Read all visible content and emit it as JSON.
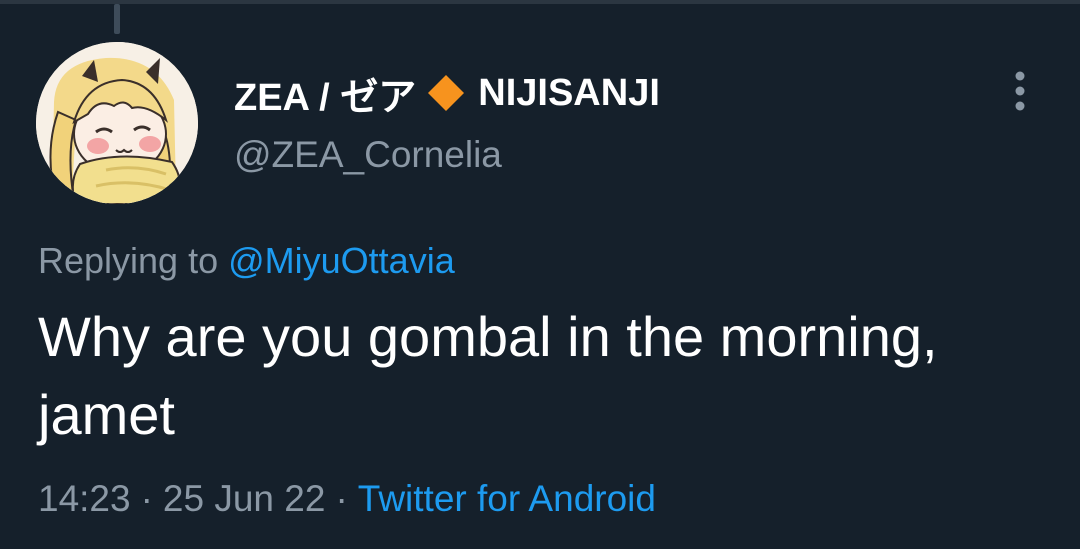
{
  "author": {
    "display_name": "ZEA / ゼア",
    "affiliation": "NIJISANJI",
    "affiliation_badge_icon": "orange-diamond-icon",
    "affiliation_badge_color": "#f7931e",
    "handle": "@ZEA_Cornelia"
  },
  "reply": {
    "prefix": "Replying to",
    "target": "@MiyuOttavia"
  },
  "tweet": {
    "text": "Why are you gombal in the morning, jamet"
  },
  "meta": {
    "time": "14:23",
    "separator": "·",
    "date": "25 Jun 22",
    "source": "Twitter for Android"
  },
  "icons": {
    "more": "more-vertical-icon"
  },
  "colors": {
    "background": "#15202b",
    "text_primary": "#ffffff",
    "text_secondary": "#8b98a5",
    "link": "#1d9bf0"
  }
}
